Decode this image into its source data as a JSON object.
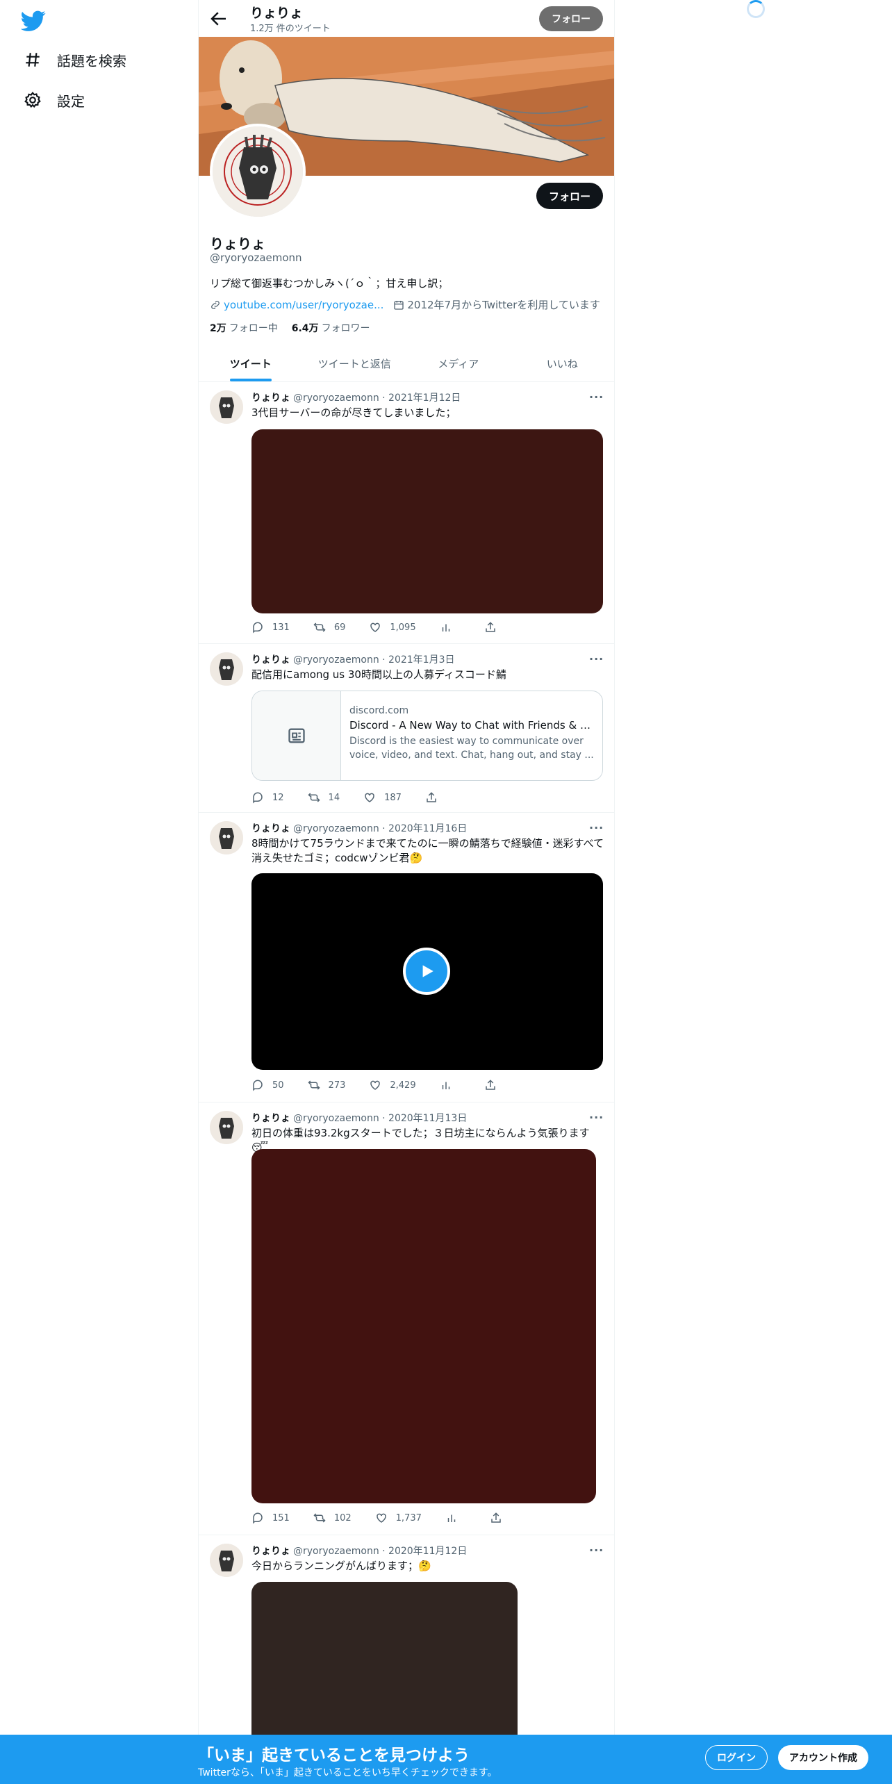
{
  "nav": {
    "logo": "twitter-bird-icon",
    "items": [
      {
        "label": "話題を検索",
        "icon": "hashtag-icon"
      },
      {
        "label": "設定",
        "icon": "gear-icon"
      }
    ]
  },
  "header": {
    "name": "りょりょ",
    "tweet_count": "1.2万 件のツイート",
    "follow_label": "フォロー"
  },
  "profile": {
    "name": "りょりょ",
    "handle": "@ryoryozaemonn",
    "bio": "リプ総て御返事むつかしみヽ(´ｏ｀；甘え申し訳；",
    "link": "youtube.com/user/ryoryozae...",
    "joined": "2012年7月からTwitterを利用しています",
    "following_count": "2万",
    "following_label": "フォロー中",
    "followers_count": "6.4万",
    "followers_label": "フォロワー",
    "follow_label": "フォロー"
  },
  "tabs": [
    "ツイート",
    "ツイートと返信",
    "メディア",
    "いいね"
  ],
  "tweets": [
    {
      "name": "りょりょ",
      "handle": "@ryoryozaemonn",
      "date": "· 2021年1月12日",
      "text": "3代目サーバーの命が尽きてしまいました；",
      "reply": "131",
      "retweet": "69",
      "like": "1,095"
    },
    {
      "name": "りょりょ",
      "handle": "@ryoryozaemonn",
      "date": "· 2021年1月3日",
      "text": "配信用にamong us 30時間以上の人募ディスコード鯖",
      "card": {
        "domain": "discord.com",
        "title": "Discord - A New Way to Chat with Friends & Com...",
        "desc": "Discord is the easiest way to communicate over voice, video, and text. Chat, hang out, and stay ..."
      },
      "reply": "12",
      "retweet": "14",
      "like": "187"
    },
    {
      "name": "りょりょ",
      "handle": "@ryoryozaemonn",
      "date": "· 2020年11月16日",
      "text": "8時間かけて75ラウンドまで来てたのに一瞬の鯖落ちで経験値・迷彩すべて消え失せたゴミ；codcwゾンビ君🤔",
      "reply": "50",
      "retweet": "273",
      "like": "2,429"
    },
    {
      "name": "りょりょ",
      "handle": "@ryoryozaemonn",
      "date": "· 2020年11月13日",
      "text": "初日の体重は93.2kgスタートでした；３日坊主にならんよう気張ります😴",
      "reply": "151",
      "retweet": "102",
      "like": "1,737"
    },
    {
      "name": "りょりょ",
      "handle": "@ryoryozaemonn",
      "date": "· 2020年11月12日",
      "text": "今日からランニングがんばります；🤔"
    }
  ],
  "bottom": {
    "title": "「いま」起きていることを見つけよう",
    "subtitle": "Twitterなら、「いま」起きていることをいち早くチェックできます。",
    "login": "ログイン",
    "signup": "アカウント作成"
  },
  "colors": {
    "accent": "#1d9bf0",
    "media_dark_red": "#3d1612",
    "media_red": "#421210",
    "media_brown": "#302521"
  }
}
